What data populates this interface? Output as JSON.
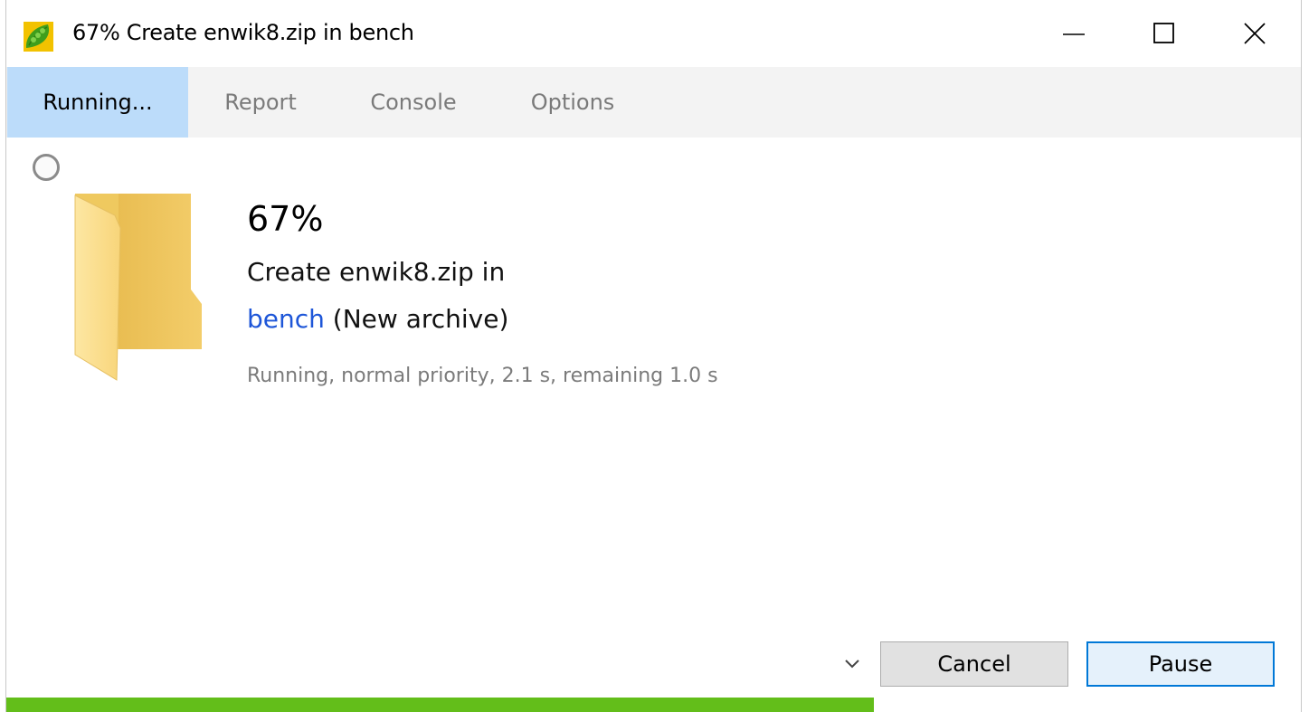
{
  "window": {
    "title": "67% Create enwik8.zip in bench",
    "controls": {
      "minimize": "minimize-icon",
      "maximize": "maximize-icon",
      "close": "close-icon"
    }
  },
  "tabs": [
    {
      "label": "Running...",
      "active": true
    },
    {
      "label": "Report",
      "active": false
    },
    {
      "label": "Console",
      "active": false
    },
    {
      "label": "Options",
      "active": false
    }
  ],
  "operation": {
    "percent_label": "67%",
    "line1": "Create enwik8.zip in",
    "destination_link": "bench",
    "destination_suffix": " (New archive)",
    "status": "Running, normal priority, 2.1 s, remaining 1.0 s"
  },
  "buttons": {
    "cancel": "Cancel",
    "pause": "Pause"
  },
  "progress": {
    "fraction": 0.67
  },
  "colors": {
    "accent": "#0078d7",
    "tab_active_bg": "#bcdcfa",
    "progress_fill": "#63be1a",
    "link": "#1e56d8"
  }
}
